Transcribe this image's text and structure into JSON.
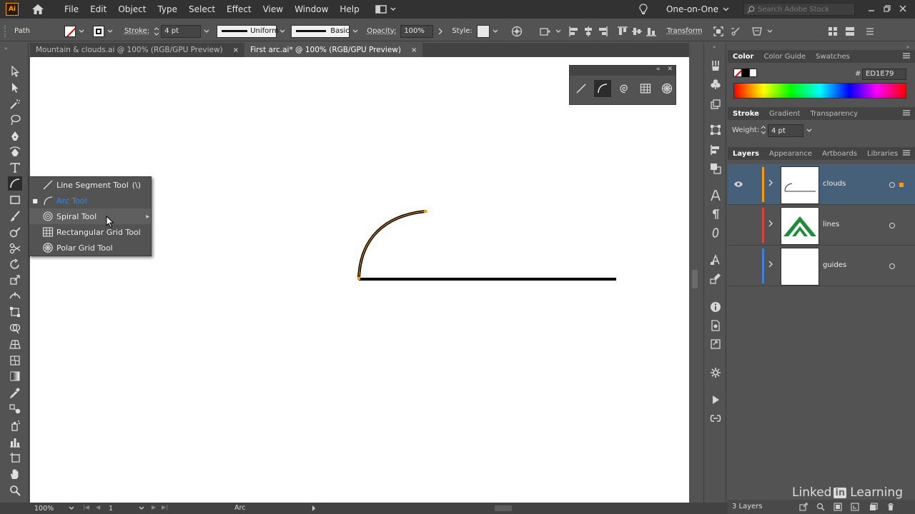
{
  "menubar": {
    "logo": "Ai",
    "menus": [
      "File",
      "Edit",
      "Object",
      "Type",
      "Select",
      "Effect",
      "View",
      "Window",
      "Help"
    ],
    "workspace": "One-on-One",
    "search_placeholder": "Search Adobe Stock"
  },
  "control": {
    "selection_label": "Path",
    "stroke_label": "Stroke:",
    "stroke_weight": "4 pt",
    "profile": "Uniform",
    "brush": "Basic",
    "opacity_label": "Opacity:",
    "opacity": "100%",
    "style_label": "Style:",
    "transform_label": "Transform"
  },
  "tabs": [
    {
      "label": "Mountain & clouds.ai @ 100% (RGB/GPU Preview)",
      "close": "×"
    },
    {
      "label": "First arc.ai* @ 100% (RGB/GPU Preview)",
      "close": "×"
    }
  ],
  "flyout": {
    "items": [
      {
        "label": "Line Segment Tool",
        "shortcut": "(\\)",
        "icon": "line-segment-icon"
      },
      {
        "label": "Arc Tool",
        "shortcut": "",
        "icon": "arc-icon"
      },
      {
        "label": "Spiral Tool",
        "shortcut": "",
        "icon": "spiral-icon"
      },
      {
        "label": "Rectangular Grid Tool",
        "shortcut": "",
        "icon": "rect-grid-icon"
      },
      {
        "label": "Polar Grid Tool",
        "shortcut": "",
        "icon": "polar-grid-icon"
      }
    ],
    "selected": "Arc Tool",
    "hovered": "Spiral Tool"
  },
  "color_panel": {
    "tabs": [
      "Color",
      "Color Guide",
      "Swatches"
    ],
    "hash": "#",
    "hex": "ED1E79"
  },
  "stroke_panel": {
    "tabs": [
      "Stroke",
      "Gradient",
      "Transparency"
    ],
    "weight_label": "Weight:",
    "weight": "4 pt"
  },
  "layers_panel": {
    "tabs": [
      "Layers",
      "Appearance",
      "Artboards",
      "Libraries"
    ],
    "layers": [
      {
        "name": "clouds",
        "color": "#ff9a00",
        "selected": true
      },
      {
        "name": "lines",
        "color": "#e0403a",
        "selected": false
      },
      {
        "name": "guides",
        "color": "#3f7fe0",
        "selected": false
      }
    ],
    "count": "3 Layers"
  },
  "status": {
    "zoom": "100%",
    "artboard": "1",
    "tool": "Arc"
  },
  "colors": {
    "selection_orange": "#ff9a00",
    "selected_blue": "#2d8ceb"
  },
  "watermark": {
    "linked": "Linked",
    "in": "in",
    "learning": "Learning"
  }
}
